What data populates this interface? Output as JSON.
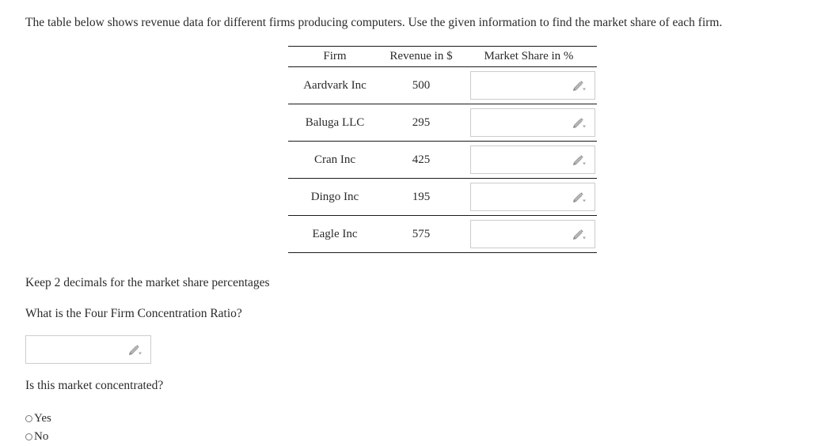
{
  "prompt": "The table below shows revenue data for different firms producing computers. Use the given information to find the market share of each firm.",
  "table": {
    "headers": {
      "firm": "Firm",
      "revenue": "Revenue in $",
      "market_share": "Market Share in %"
    },
    "rows": [
      {
        "firm": "Aardvark Inc",
        "revenue": "500",
        "market_share": ""
      },
      {
        "firm": "Baluga LLC",
        "revenue": "295",
        "market_share": ""
      },
      {
        "firm": "Cran Inc",
        "revenue": "425",
        "market_share": ""
      },
      {
        "firm": "Dingo Inc",
        "revenue": "195",
        "market_share": ""
      },
      {
        "firm": "Eagle Inc",
        "revenue": "575",
        "market_share": ""
      }
    ]
  },
  "notes": {
    "decimals": "Keep 2 decimals for the market share percentages",
    "four_firm_question": "What is the Four Firm Concentration Ratio?",
    "concentrated_question": "Is this market concentrated?"
  },
  "four_firm_answer": {
    "value": ""
  },
  "radios": [
    {
      "label": "Yes",
      "selected": false
    },
    {
      "label": "No",
      "selected": false
    }
  ],
  "icons": {
    "editor": "pencil-dropdown-icon"
  },
  "colors": {
    "text": "#2b2b2b",
    "rule": "#1a1a1a",
    "input_border": "#cccccc",
    "icon": "#9a9a9a",
    "background": "#ffffff"
  }
}
